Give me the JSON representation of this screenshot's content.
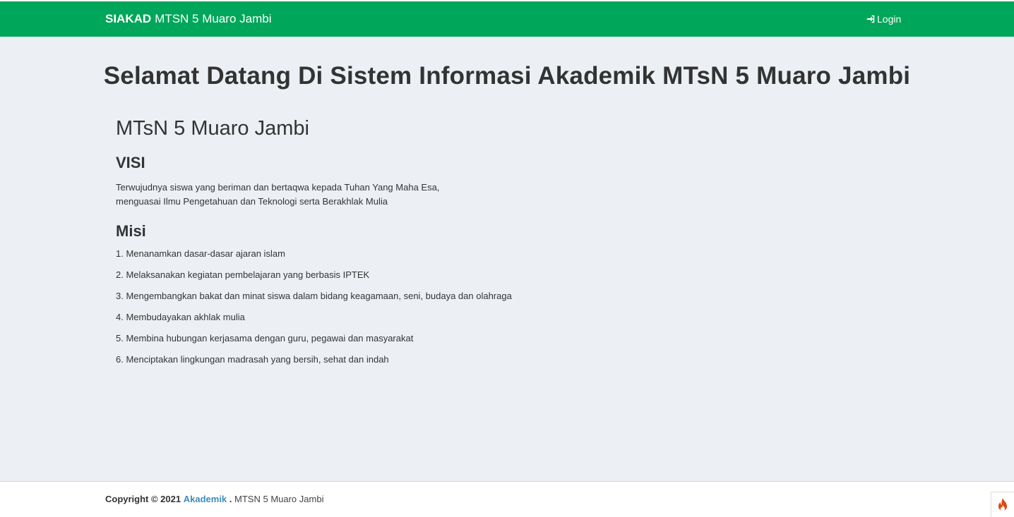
{
  "navbar": {
    "brand_bold": "SIAKAD",
    "brand_rest": "MTSN 5 Muaro Jambi",
    "login_label": "Login",
    "login_icon": "sign-in-icon",
    "color": "#00a65a"
  },
  "main": {
    "welcome": "Selamat Datang Di Sistem Informasi Akademik MTsN 5 Muaro Jambi",
    "school_name": "MTsN 5 Muaro Jambi",
    "visi_title": "VISI",
    "visi_line1": "Terwujudnya siswa yang beriman dan bertaqwa kepada Tuhan Yang Maha Esa,",
    "visi_line2": "menguasai Ilmu Pengetahuan dan Teknologi serta Berakhlak Mulia",
    "misi_title": "Misi",
    "misi_items": [
      "1. Menanamkan dasar-dasar ajaran islam",
      "2. Melaksanakan kegiatan pembelajaran yang berbasis IPTEK",
      "3. Mengembangkan bakat dan minat siswa dalam bidang keagamaan, seni, budaya dan olahraga",
      "4. Membudayakan akhlak mulia",
      "5. Membina hubungan kerjasama dengan guru, pegawai dan masyarakat",
      "6. Menciptakan lingkungan madrasah yang bersih, sehat dan indah"
    ]
  },
  "footer": {
    "copyright": "Copyright © 2021",
    "link_text": "Akademik",
    "separator": ".",
    "rest": "MTSN 5 Muaro Jambi",
    "link_color": "#3c8dbc"
  },
  "debug_toolbar": {
    "icon": "flame-icon",
    "color": "#dd4814"
  }
}
